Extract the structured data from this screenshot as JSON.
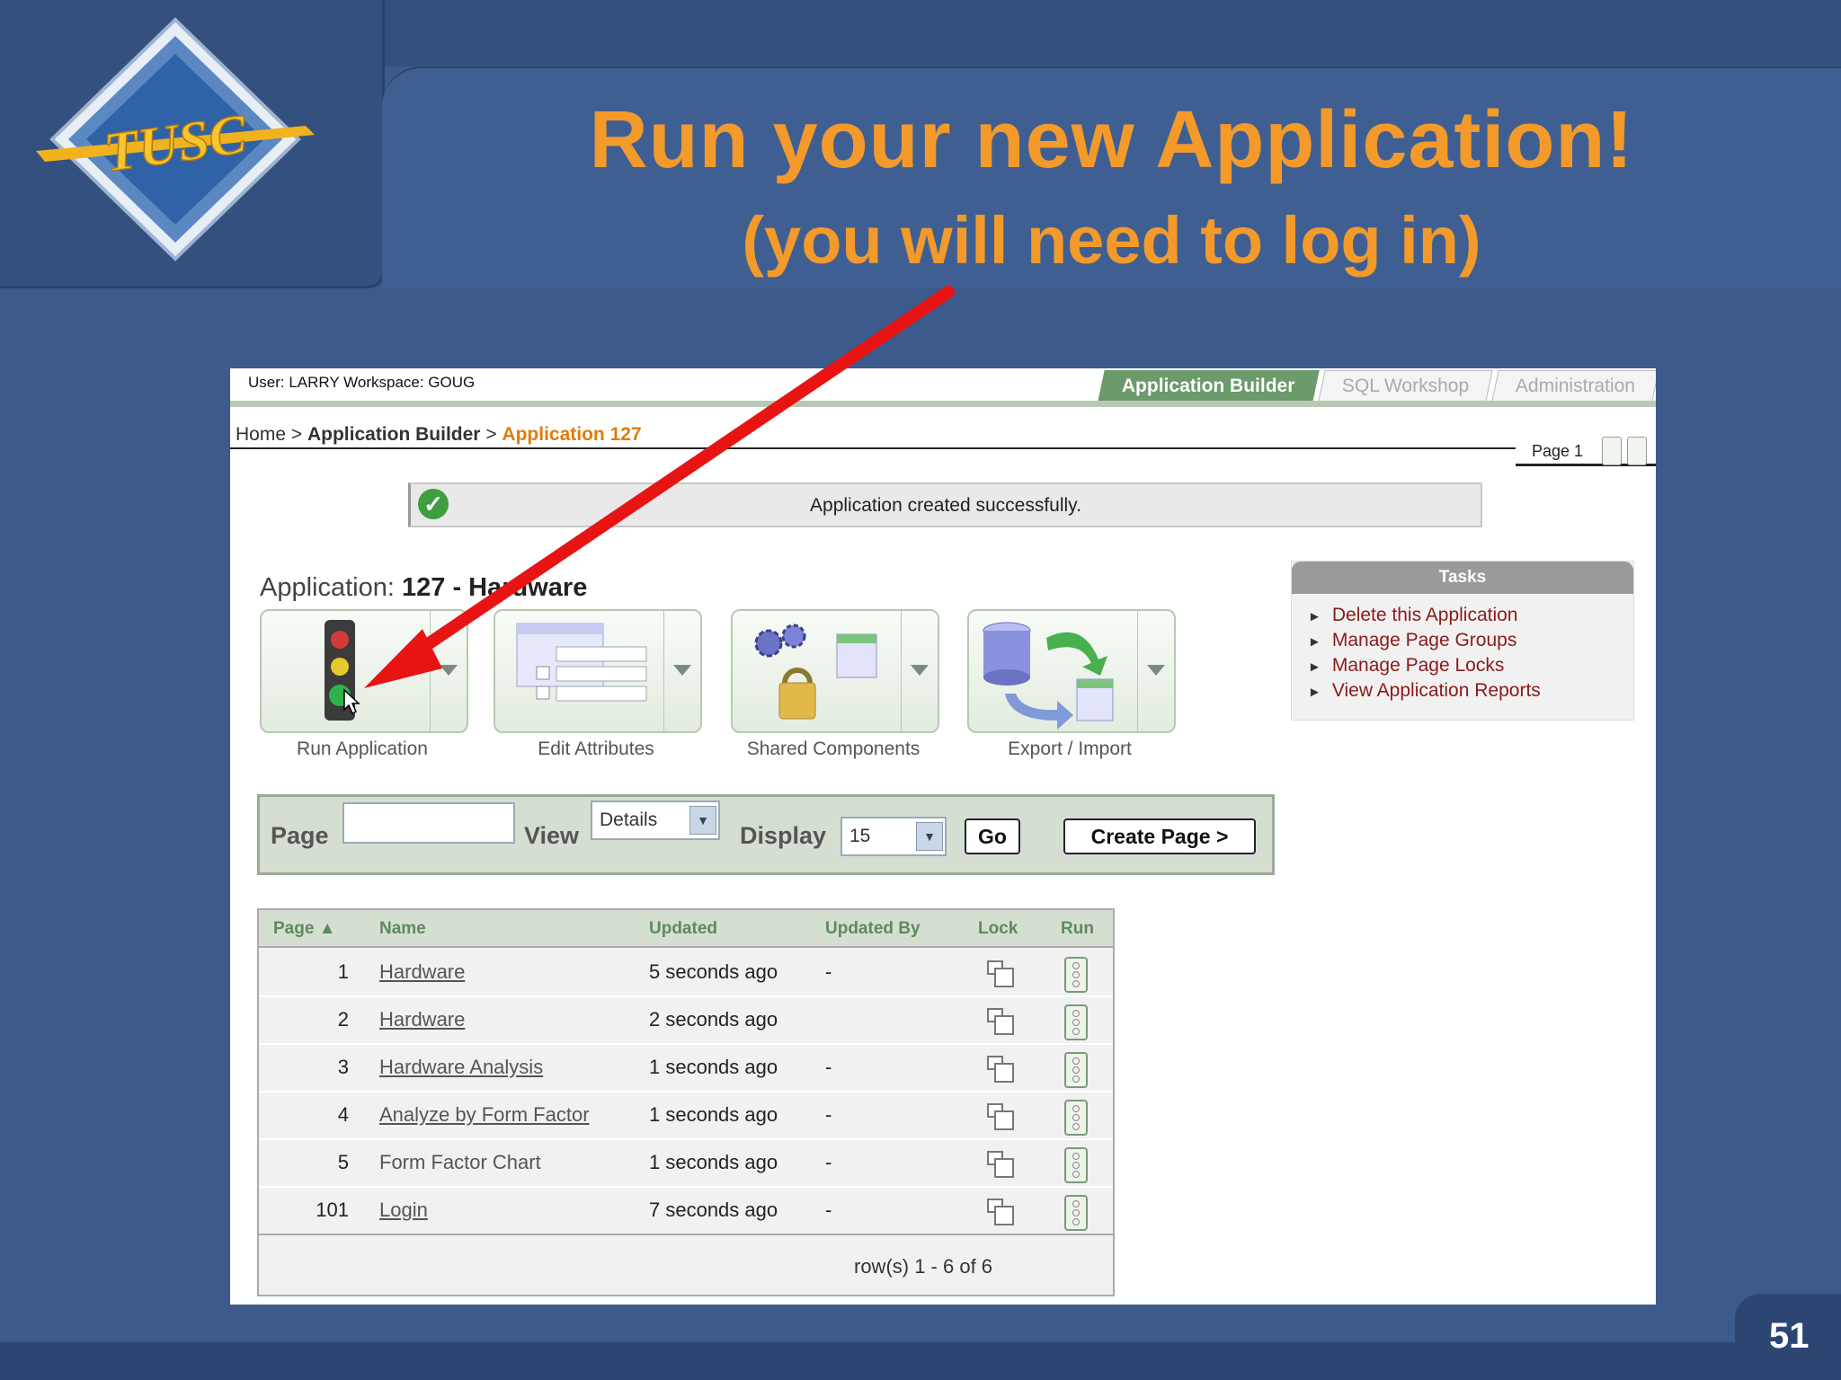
{
  "slide": {
    "title": "Run your new Application!",
    "subtitle": "(you will need to log in)",
    "page_number": "51",
    "logo_text": "TUSC"
  },
  "app": {
    "user_info": "User: LARRY   Workspace: GOUG",
    "tabs": [
      "Application Builder",
      "SQL Workshop",
      "Administration"
    ],
    "active_tab": "Application Builder",
    "breadcrumb": {
      "home": "Home",
      "sep": " > ",
      "builder": "Application Builder",
      "current": "Application 127"
    },
    "page_label": "Page 1",
    "success_message": "Application created successfully.",
    "app_title_prefix": "Application: ",
    "app_title": "127 - Hardware",
    "actions": [
      {
        "label": "Run Application",
        "icon": "traffic-light-icon"
      },
      {
        "label": "Edit Attributes",
        "icon": "edit-form-icon"
      },
      {
        "label": "Shared Components",
        "icon": "shared-components-icon"
      },
      {
        "label": "Export / Import",
        "icon": "export-import-icon"
      }
    ],
    "search": {
      "page_label": "Page",
      "page_value": "",
      "view_label": "View",
      "view_value": "Details",
      "display_label": "Display",
      "display_value": "15",
      "go_label": "Go",
      "create_label": "Create Page >"
    },
    "grid": {
      "columns": [
        "Page ▲",
        "Name",
        "Updated",
        "Updated By",
        "Lock",
        "Run"
      ],
      "rows": [
        {
          "page": "1",
          "name": "Hardware",
          "updated": "5 seconds ago",
          "by": "-",
          "link": true
        },
        {
          "page": "2",
          "name": "Hardware",
          "updated": "2 seconds ago",
          "by": "",
          "link": true
        },
        {
          "page": "3",
          "name": "Hardware Analysis",
          "updated": "1 seconds ago",
          "by": "-",
          "link": true
        },
        {
          "page": "4",
          "name": "Analyze by Form Factor",
          "updated": "1 seconds ago",
          "by": "-",
          "link": true
        },
        {
          "page": "5",
          "name": "Form Factor Chart",
          "updated": "1 seconds ago",
          "by": "-",
          "link": false
        },
        {
          "page": "101",
          "name": "Login",
          "updated": "7 seconds ago",
          "by": "-",
          "link": true
        }
      ],
      "footer": "row(s) 1 - 6 of 6"
    },
    "tasks": {
      "title": "Tasks",
      "items": [
        "Delete this Application",
        "Manage Page Groups",
        "Manage Page Locks",
        "View Application Reports"
      ]
    }
  },
  "colors": {
    "title": "#f39a2a",
    "background": "#3c5a8c",
    "arrow": "#e81414"
  }
}
